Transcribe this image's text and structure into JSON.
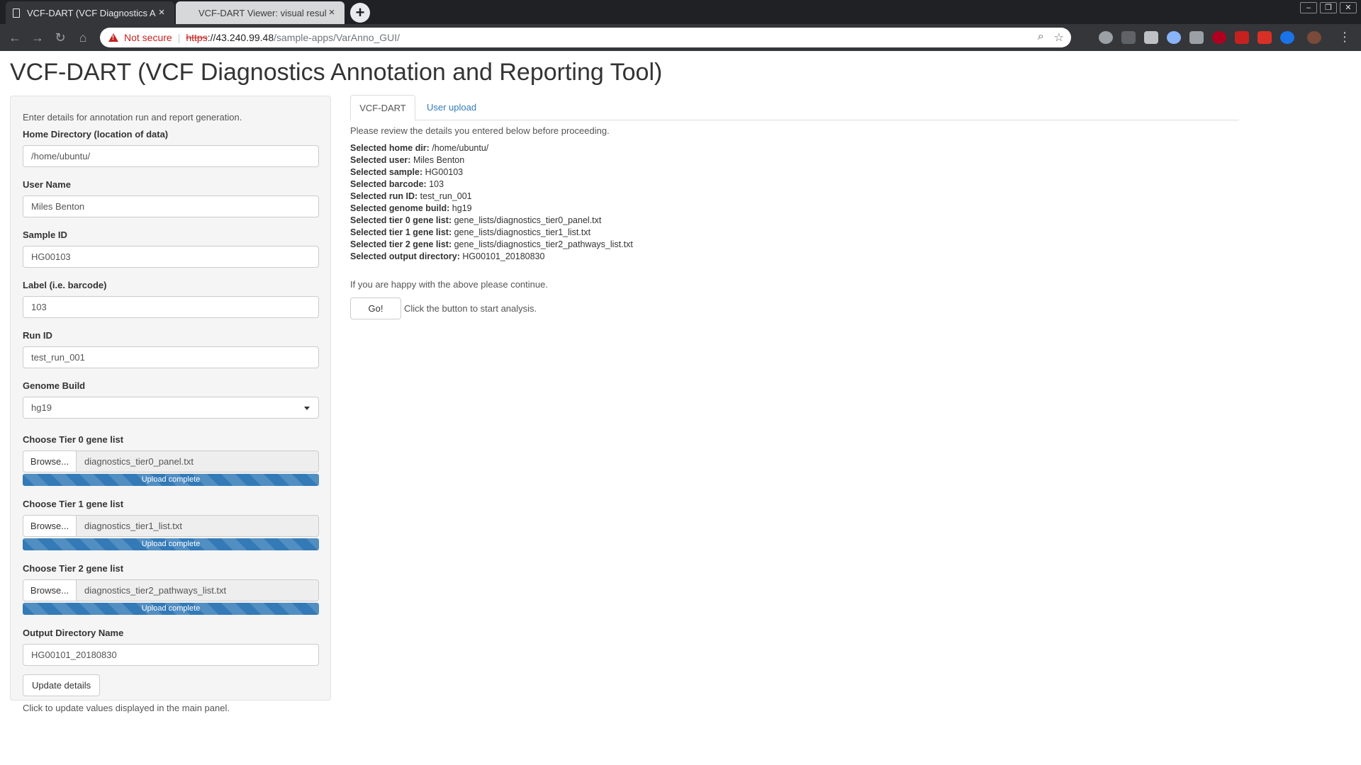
{
  "browser": {
    "tabs": [
      {
        "title": "VCF-DART (VCF Diagnostics Ann",
        "close": "×"
      },
      {
        "title": "VCF-DART Viewer: visual results",
        "close": "×"
      }
    ],
    "new_tab": "+",
    "window_buttons": [
      "–",
      "❐",
      "✕"
    ],
    "not_secure": "Not secure",
    "url_scheme": "https",
    "url_host": "://43.240.99.48",
    "url_path": "/sample-apps/VarAnno_GUI/"
  },
  "page_title": "VCF-DART (VCF Diagnostics Annotation and Reporting Tool)",
  "sidebar": {
    "intro": "Enter details for annotation run and report generation.",
    "home_dir": {
      "label": "Home Directory (location of data)",
      "value": "/home/ubuntu/"
    },
    "user_name": {
      "label": "User Name",
      "value": "Miles Benton"
    },
    "sample_id": {
      "label": "Sample ID",
      "value": "HG00103"
    },
    "barcode": {
      "label": "Label (i.e. barcode)",
      "value": "103"
    },
    "run_id": {
      "label": "Run ID",
      "value": "test_run_001"
    },
    "genome_build": {
      "label": "Genome Build",
      "value": "hg19"
    },
    "tier0": {
      "label": "Choose Tier 0 gene list",
      "browse": "Browse...",
      "file": "diagnostics_tier0_panel.txt",
      "progress": "Upload complete"
    },
    "tier1": {
      "label": "Choose Tier 1 gene list",
      "browse": "Browse...",
      "file": "diagnostics_tier1_list.txt",
      "progress": "Upload complete"
    },
    "tier2": {
      "label": "Choose Tier 2 gene list",
      "browse": "Browse...",
      "file": "diagnostics_tier2_pathways_list.txt",
      "progress": "Upload complete"
    },
    "output_dir": {
      "label": "Output Directory Name",
      "value": "HG00101_20180830"
    },
    "update_button": "Update details",
    "update_help": "Click to update values displayed in the main panel."
  },
  "main": {
    "tabs": [
      "VCF-DART",
      "User upload"
    ],
    "review_text": "Please review the details you entered below before proceeding.",
    "details": [
      {
        "key": "Selected home dir:",
        "value": "/home/ubuntu/"
      },
      {
        "key": "Selected user:",
        "value": "Miles Benton"
      },
      {
        "key": "Selected sample:",
        "value": "HG00103"
      },
      {
        "key": "Selected barcode:",
        "value": "103"
      },
      {
        "key": "Selected run ID:",
        "value": "test_run_001"
      },
      {
        "key": "Selected genome build:",
        "value": "hg19"
      },
      {
        "key": "Selected tier 0 gene list:",
        "value": "gene_lists/diagnostics_tier0_panel.txt"
      },
      {
        "key": "Selected tier 1 gene list:",
        "value": "gene_lists/diagnostics_tier1_list.txt"
      },
      {
        "key": "Selected tier 2 gene list:",
        "value": "gene_lists/diagnostics_tier2_pathways_list.txt"
      },
      {
        "key": "Selected output directory:",
        "value": "HG00101_20180830"
      }
    ],
    "happy_text": "If you are happy with the above please continue.",
    "go_button": "Go!",
    "go_help": "Click the button to start analysis."
  },
  "colors": {
    "link": "#337ab7",
    "progress": "#337ab7",
    "warning": "#c5221f"
  }
}
